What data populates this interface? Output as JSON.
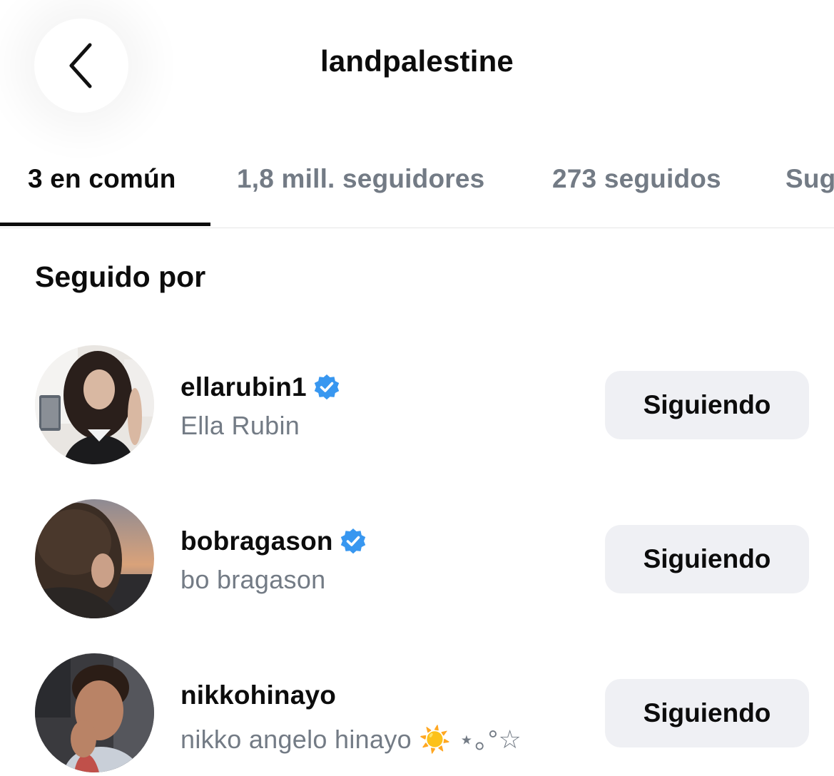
{
  "header": {
    "title": "landpalestine",
    "back_icon": "chevron-left-icon"
  },
  "tabs": [
    {
      "label": "3 en común",
      "active": true
    },
    {
      "label": "1,8 mill. seguidores",
      "active": false
    },
    {
      "label": "273 seguidos",
      "active": false
    },
    {
      "label": "Sug",
      "active": false
    }
  ],
  "section": {
    "title": "Seguido por"
  },
  "users": [
    {
      "username": "ellarubin1",
      "full_name": "Ella Rubin",
      "verified": true,
      "button_label": "Siguiendo"
    },
    {
      "username": "bobragason",
      "full_name": "bo bragason",
      "verified": true,
      "button_label": "Siguiendo"
    },
    {
      "username": "nikkohinayo",
      "full_name": "nikko angelo hinayo ☀️ ⋆｡°☆",
      "verified": false,
      "button_label": "Siguiendo"
    }
  ],
  "colors": {
    "text_primary": "#0c0c0c",
    "text_secondary": "#737b85",
    "button_bg": "#eff0f4",
    "verified_blue": "#3897f0",
    "divider": "#e6e6e6"
  }
}
